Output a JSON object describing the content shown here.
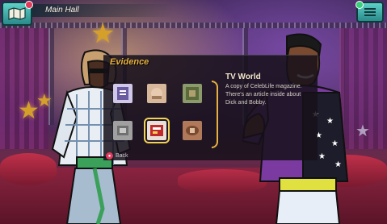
{
  "location": {
    "name": "Main Hall"
  },
  "icons": {
    "map": "map-icon",
    "menu": "menu-icon"
  },
  "evidence": {
    "title": "Evidence",
    "items": [
      {
        "name": "evidence-1",
        "color": "#cfc8e8"
      },
      {
        "name": "evidence-2",
        "color": "#d8b89a"
      },
      {
        "name": "evidence-3",
        "color": "#8a9a6a"
      },
      {
        "name": "evidence-4",
        "color": "#a0a0a0"
      },
      {
        "name": "evidence-5-celeblife-magazine",
        "color": "#e8e0d8",
        "selected": true
      },
      {
        "name": "evidence-6",
        "color": "#b07a5a"
      }
    ],
    "selected": {
      "title": "TV World",
      "description": "A copy of CelebLife magazine. There's an article inside about Dick and Bobby."
    },
    "back_label": "Back"
  },
  "colors": {
    "accent": "#e8b040",
    "button_teal": "#4ab8b0",
    "notif_red": "#e23a5a",
    "notif_green": "#3ad07a"
  }
}
